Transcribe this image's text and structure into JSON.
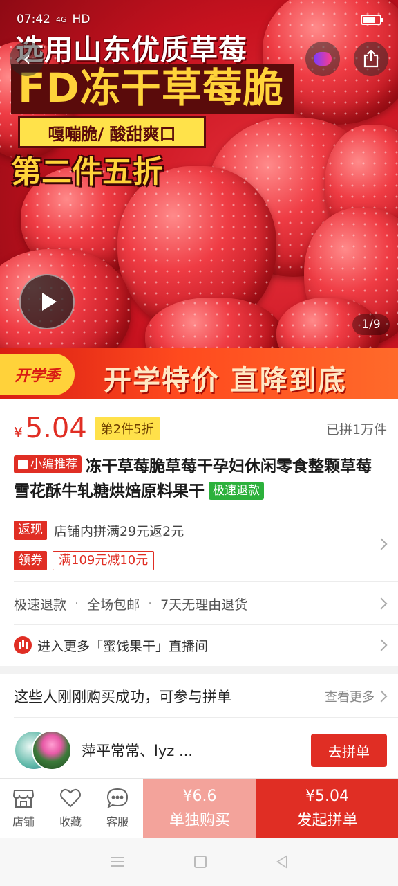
{
  "status_bar": {
    "time": "07:42",
    "signal": "4G",
    "network": "HD"
  },
  "hero": {
    "headline": "选用山东优质草莓",
    "product_name": "FD冻干草莓脆",
    "feature": "嘎嘣脆/ 酸甜爽口",
    "offer": "第二件五折",
    "counter": "1/9"
  },
  "promo_banner": {
    "logo_text": "开学季",
    "slogan": "开学特价  直降到底"
  },
  "price": {
    "currency": "¥",
    "value": "5.04",
    "discount_tag": "第2件5折",
    "sold": "已拼1万件"
  },
  "product": {
    "recommend_tag": "小编推荐",
    "title": "冻干草莓脆草莓干孕妇休闲零食整颗草莓雪花酥牛轧糖烘焙原料果干",
    "refund_tag": "极速退款"
  },
  "promotions": [
    {
      "tag": "返现",
      "text": "店铺内拼满29元返2元"
    },
    {
      "tag": "领券",
      "coupon": "满109元减10元"
    }
  ],
  "services": [
    "极速退款",
    "全场包邮",
    "7天无理由退货"
  ],
  "service_separator": "·",
  "live": {
    "text": "进入更多「蜜饯果干」直播间"
  },
  "group_buy": {
    "heading": "这些人刚刚购买成功，可参与拼单",
    "more": "查看更多",
    "names": "萍平常常、lyz ...",
    "join_label": "去拼单"
  },
  "bottom_bar": {
    "store": "店铺",
    "favorite": "收藏",
    "service": "客服",
    "single_price": "¥6.6",
    "single_label": "单独购买",
    "group_price": "¥5.04",
    "group_label": "发起拼单"
  },
  "colors": {
    "accent": "#e02e24",
    "yellow_tag": "#ffe14a",
    "green_tag": "#2cb13c",
    "single_buy": "#f3a39b"
  },
  "icons": [
    "back-icon",
    "brand-icon",
    "share-icon",
    "play-icon",
    "thumb-icon",
    "live-icon",
    "store-icon",
    "heart-icon",
    "chat-icon"
  ]
}
